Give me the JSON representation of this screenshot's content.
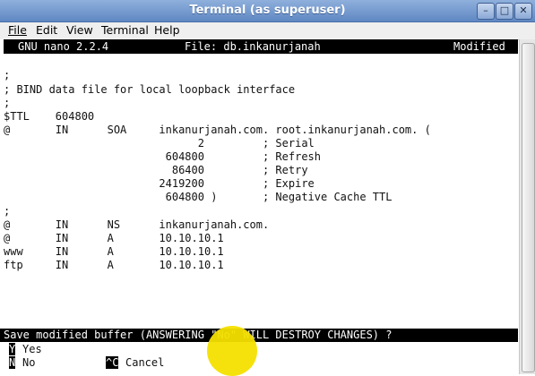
{
  "window": {
    "title": "Terminal (as superuser)",
    "buttons": {
      "minimize": "–",
      "maximize": "□",
      "close": "✕"
    }
  },
  "menu": [
    "File",
    "Edit",
    "View",
    "Terminal",
    "Help"
  ],
  "nano": {
    "version": "GNU nano 2.2.4",
    "file": "File: db.inkanurjanah",
    "status": "Modified"
  },
  "content_lines": [
    ";",
    "; BIND data file for local loopback interface",
    ";",
    "$TTL    604800",
    "@       IN      SOA     inkanurjanah.com. root.inkanurjanah.com. (",
    "                              2         ; Serial",
    "                         604800         ; Refresh",
    "                          86400         ; Retry",
    "                        2419200         ; Expire",
    "                         604800 )       ; Negative Cache TTL",
    ";",
    "@       IN      NS      inkanurjanah.com.",
    "@       IN      A       10.10.10.1",
    "www     IN      A       10.10.10.1",
    "ftp     IN      A       10.10.10.1"
  ],
  "prompt": "Save modified buffer (ANSWERING \"No\" WILL DESTROY CHANGES) ?",
  "options": [
    {
      "key": "Y",
      "label": "Yes"
    },
    {
      "key": "N",
      "label": "No"
    },
    {
      "key": "^C",
      "label": "Cancel"
    }
  ],
  "colors": {
    "titlebar": "#6f94cc",
    "highlight": "#f4e000"
  }
}
